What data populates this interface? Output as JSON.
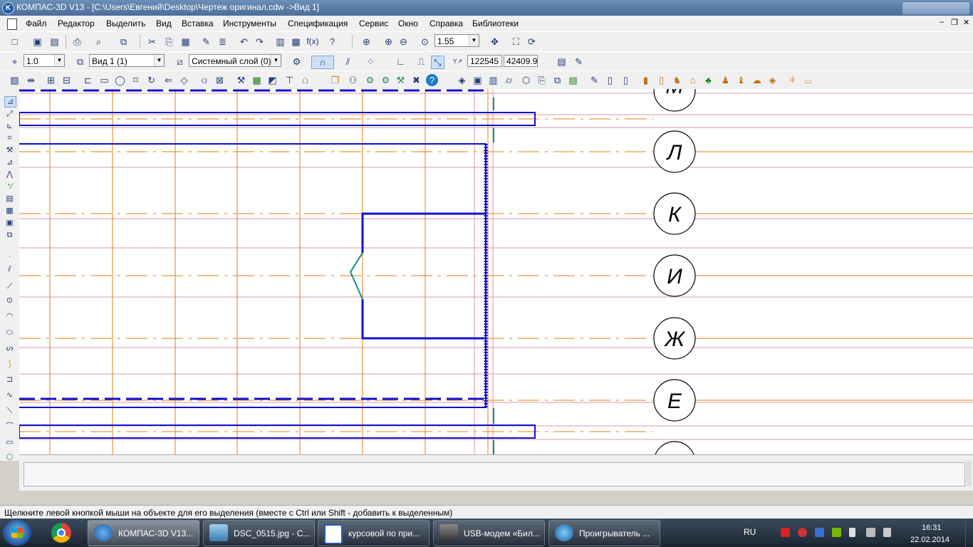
{
  "window": {
    "title": "КОМПАС-3D V13 - [C:\\Users\\Евгений\\Desktop\\Чертеж оригинал.cdw ->Вид 1]"
  },
  "menu": {
    "items": [
      "Файл",
      "Редактор",
      "Выделить",
      "Вид",
      "Вставка",
      "Инструменты",
      "Спецификация",
      "Сервис",
      "Окно",
      "Справка",
      "Библиотеки"
    ]
  },
  "toolbar": {
    "zoom_value": "1.55",
    "step_value": "1.0",
    "view_value": "Вид 1 (1)",
    "layer_value": "Системный слой (0)",
    "coord_x": "122545",
    "coord_y": "42409.9"
  },
  "drawing": {
    "axis_labels": [
      "Л",
      "К",
      "И",
      "Ж",
      "Е"
    ],
    "colors": {
      "contour": "#1010d0",
      "axis": "#e08010",
      "grid": "#d898a0",
      "teal": "#109090"
    }
  },
  "status": {
    "text": "Щелкните левой кнопкой мыши на объекте для его выделения (вместе с Ctrl или Shift - добавить к выделенным)"
  },
  "taskbar": {
    "tasks": [
      {
        "label": "КОМПАС-3D V13...",
        "icon": "kompas-icon",
        "active": true
      },
      {
        "label": "DSC_0515.jpg - С...",
        "icon": "image-viewer-icon",
        "active": false
      },
      {
        "label": "курсовой по при...",
        "icon": "word-icon",
        "active": false
      },
      {
        "label": "USB-модем «Бил...",
        "icon": "modem-icon",
        "active": false
      },
      {
        "label": "Проигрыватель ...",
        "icon": "media-player-icon",
        "active": false
      }
    ],
    "language": "RU",
    "time": "16:31",
    "date": "22.02.2014"
  }
}
